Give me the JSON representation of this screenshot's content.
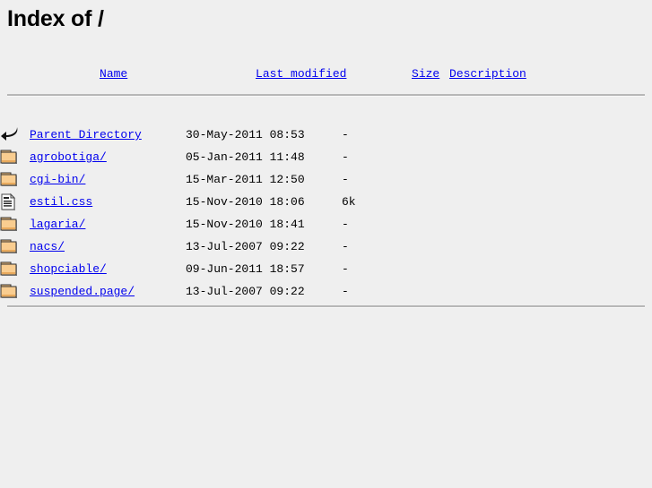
{
  "page": {
    "title": "Index of /"
  },
  "table": {
    "headers": [
      {
        "label": "Name",
        "name": "name"
      },
      {
        "label": "Last modified",
        "name": "last-modified"
      },
      {
        "label": "Size",
        "name": "size"
      },
      {
        "label": "Description",
        "name": "description"
      }
    ],
    "rows": [
      {
        "icon": "back-arrow-icon",
        "name": "Parent Directory",
        "last_modified": "30-May-2011 08:53",
        "size": "-",
        "description": ""
      },
      {
        "icon": "folder-icon",
        "name": "agrobotiga/",
        "last_modified": "05-Jan-2011 11:48",
        "size": "-",
        "description": ""
      },
      {
        "icon": "folder-icon",
        "name": "cgi-bin/",
        "last_modified": "15-Mar-2011 12:50",
        "size": "-",
        "description": ""
      },
      {
        "icon": "document-icon",
        "name": "estil.css",
        "last_modified": "15-Nov-2010 18:06",
        "size": "6k",
        "description": ""
      },
      {
        "icon": "folder-icon",
        "name": "lagaria/",
        "last_modified": "15-Nov-2010 18:41",
        "size": "-",
        "description": ""
      },
      {
        "icon": "folder-icon",
        "name": "nacs/",
        "last_modified": "13-Jul-2007 09:22",
        "size": "-",
        "description": ""
      },
      {
        "icon": "folder-icon",
        "name": "shopciable/",
        "last_modified": "09-Jun-2011 18:57",
        "size": "-",
        "description": ""
      },
      {
        "icon": "folder-icon",
        "name": "suspended.page/",
        "last_modified": "13-Jul-2007 09:22",
        "size": "-",
        "description": ""
      }
    ]
  },
  "colors": {
    "background": "#efefef",
    "link": "#0000ee",
    "text": "#000000",
    "rule": "#b7b7b7",
    "folder_body": "#f7c37e",
    "folder_outline": "#303030"
  }
}
